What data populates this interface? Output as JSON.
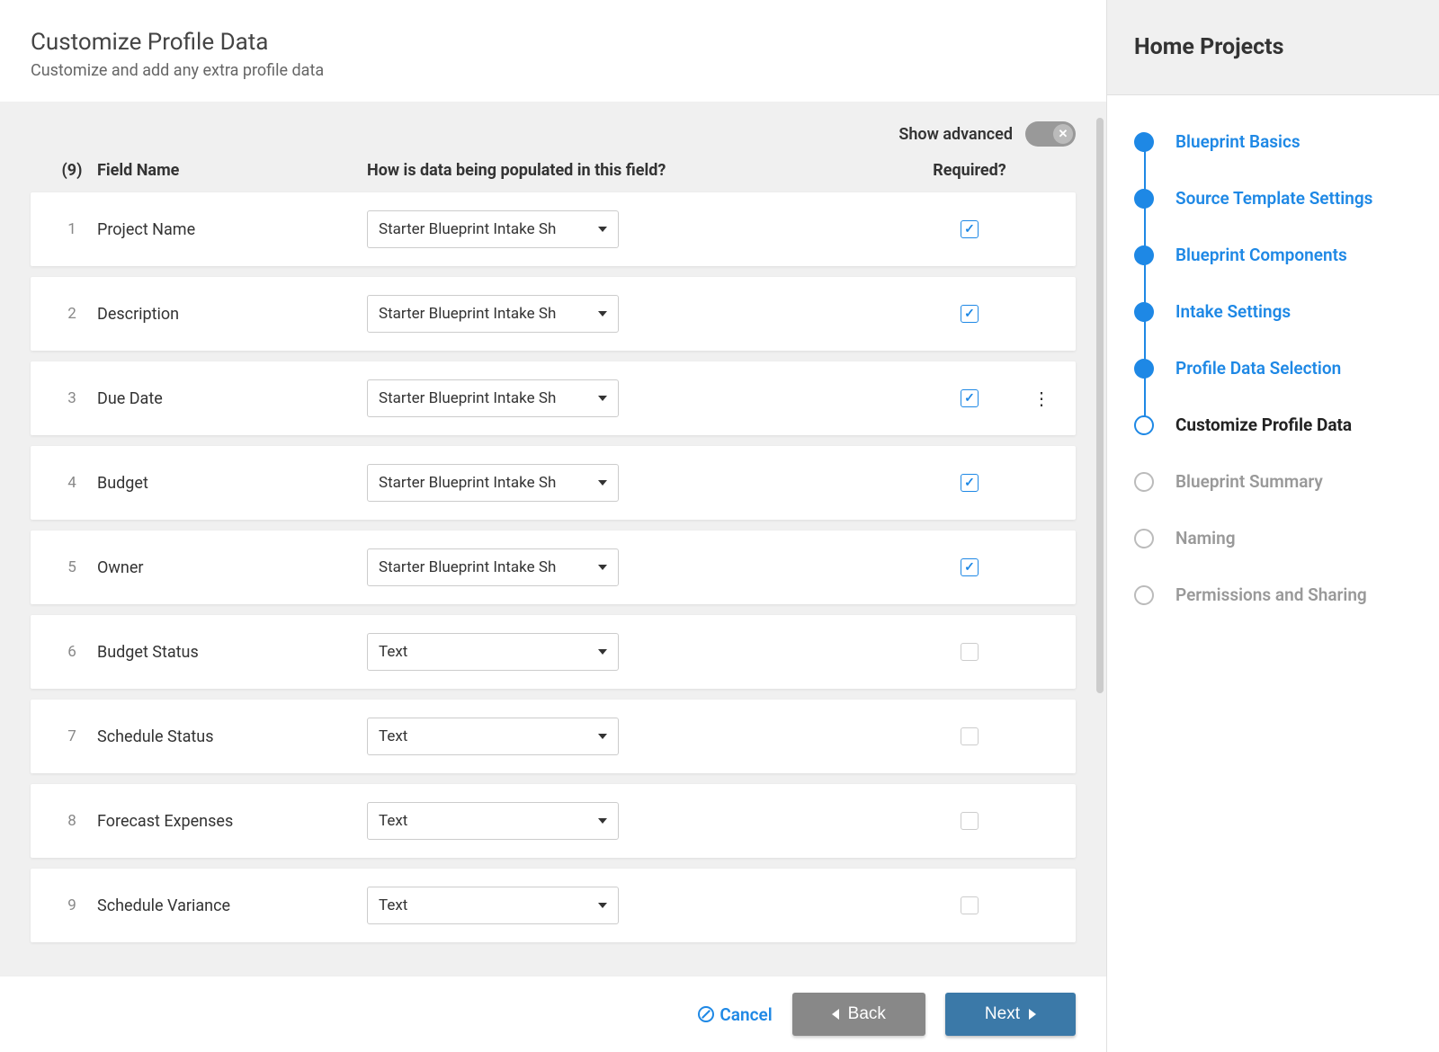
{
  "header": {
    "title": "Customize Profile Data",
    "subtitle": "Customize and add any extra profile data"
  },
  "toolbar": {
    "show_advanced_label": "Show advanced"
  },
  "table": {
    "count_label": "(9)",
    "col_name": "Field Name",
    "col_populated": "How is data being populated in this field?",
    "col_required": "Required?"
  },
  "rows": [
    {
      "num": "1",
      "name": "Project Name",
      "source": "Starter Blueprint Intake Sh",
      "required": true,
      "menu": false
    },
    {
      "num": "2",
      "name": "Description",
      "source": "Starter Blueprint Intake Sh",
      "required": true,
      "menu": false
    },
    {
      "num": "3",
      "name": "Due Date",
      "source": "Starter Blueprint Intake Sh",
      "required": true,
      "menu": true
    },
    {
      "num": "4",
      "name": "Budget",
      "source": "Starter Blueprint Intake Sh",
      "required": true,
      "menu": false
    },
    {
      "num": "5",
      "name": "Owner",
      "source": "Starter Blueprint Intake Sh",
      "required": true,
      "menu": false
    },
    {
      "num": "6",
      "name": "Budget Status",
      "source": "Text",
      "required": false,
      "menu": false
    },
    {
      "num": "7",
      "name": "Schedule Status",
      "source": "Text",
      "required": false,
      "menu": false
    },
    {
      "num": "8",
      "name": "Forecast Expenses",
      "source": "Text",
      "required": false,
      "menu": false
    },
    {
      "num": "9",
      "name": "Schedule Variance",
      "source": "Text",
      "required": false,
      "menu": false
    }
  ],
  "footer": {
    "cancel": "Cancel",
    "back": "Back",
    "next": "Next"
  },
  "sidebar": {
    "title": "Home Projects",
    "steps": [
      {
        "label": "Blueprint Basics",
        "state": "done"
      },
      {
        "label": "Source Template Settings",
        "state": "done"
      },
      {
        "label": "Blueprint Components",
        "state": "done"
      },
      {
        "label": "Intake Settings",
        "state": "done"
      },
      {
        "label": "Profile Data Selection",
        "state": "done"
      },
      {
        "label": "Customize Profile Data",
        "state": "current"
      },
      {
        "label": "Blueprint Summary",
        "state": "future"
      },
      {
        "label": "Naming",
        "state": "future"
      },
      {
        "label": "Permissions and Sharing",
        "state": "future"
      }
    ]
  }
}
